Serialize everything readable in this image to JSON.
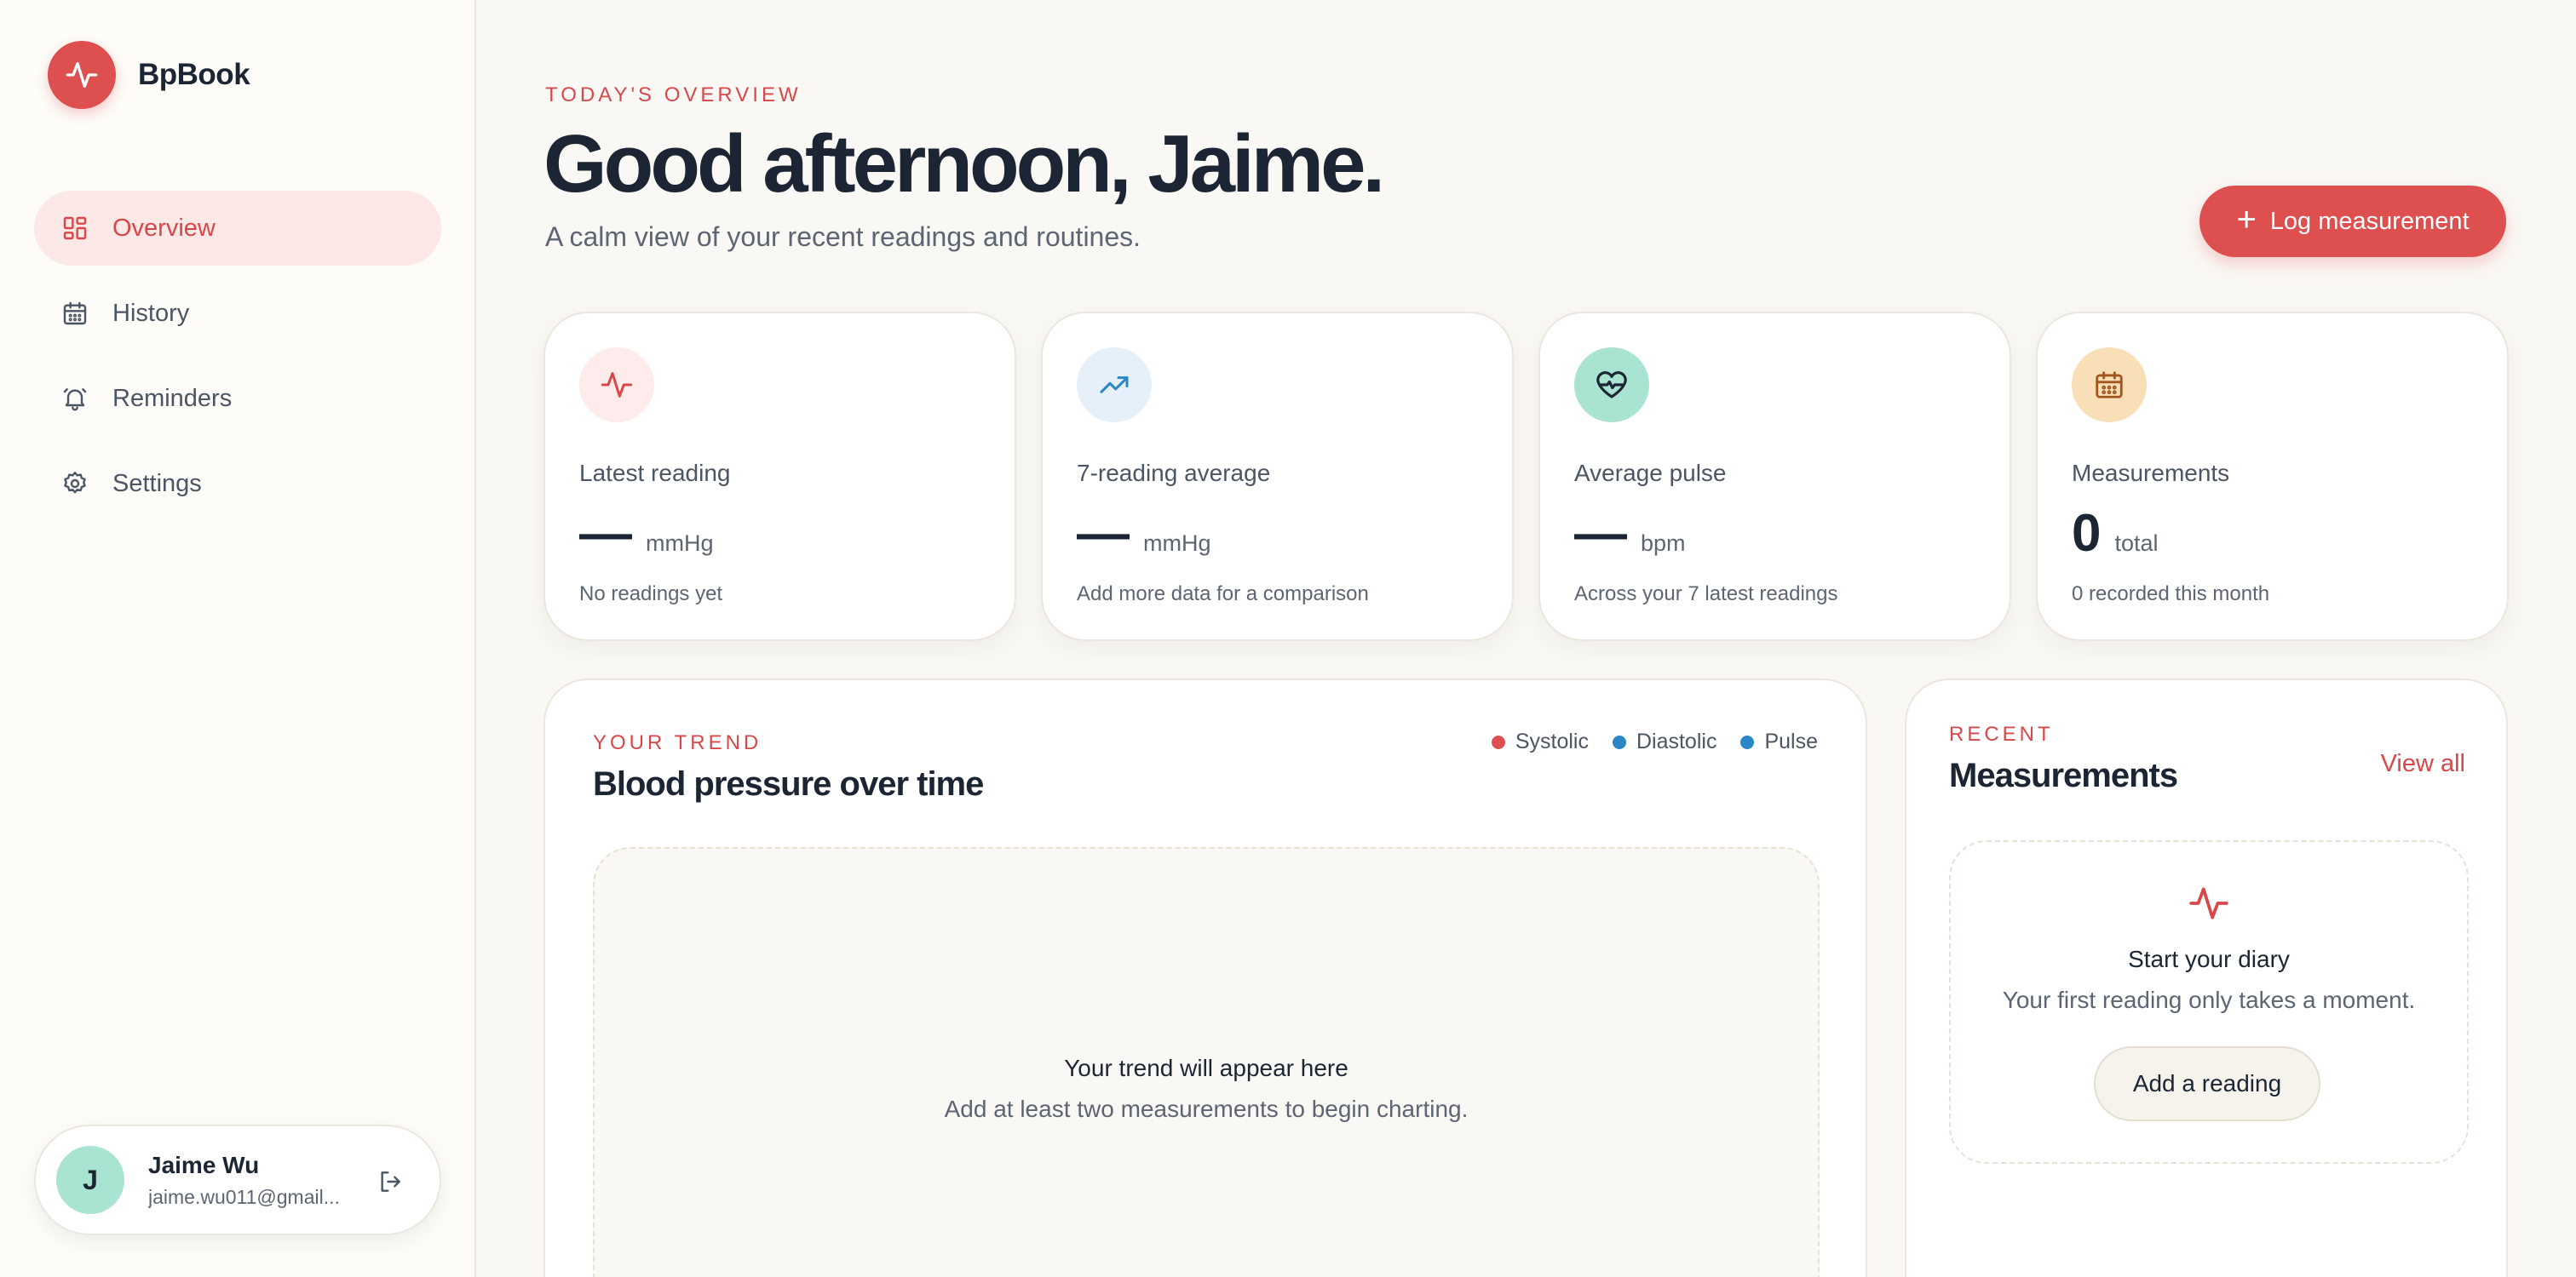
{
  "brand": {
    "name": "BpBook",
    "logo_icon": "pulse-icon",
    "accent": "#de4f4f"
  },
  "sidebar": {
    "items": [
      {
        "label": "Overview",
        "icon": "dashboard-grid-icon",
        "active": true
      },
      {
        "label": "History",
        "icon": "calendar-icon",
        "active": false
      },
      {
        "label": "Reminders",
        "icon": "bell-icon",
        "active": false
      },
      {
        "label": "Settings",
        "icon": "gear-icon",
        "active": false
      }
    ],
    "user": {
      "initial": "J",
      "name": "Jaime Wu",
      "email": "jaime.wu011@gmail...",
      "logout_icon": "logout-icon"
    }
  },
  "header": {
    "eyebrow": "TODAY'S OVERVIEW",
    "title": "Good afternoon, Jaime.",
    "subtitle": "A calm view of your recent readings and routines.",
    "log_button": {
      "icon": "+",
      "label": "Log measurement"
    }
  },
  "stats": [
    {
      "icon": "pulse-icon",
      "icon_bg": "#fdeceb",
      "icon_color": "#d8474a",
      "label": "Latest reading",
      "value": "—",
      "unit": "mmHg",
      "note": "No readings yet"
    },
    {
      "icon": "trending-up-icon",
      "icon_bg": "#e5f0fb",
      "icon_color": "#2b86c5",
      "label": "7-reading average",
      "value": "—",
      "unit": "mmHg",
      "note": "Add more data for a comparison"
    },
    {
      "icon": "heart-pulse-icon",
      "icon_bg": "#a9e4d3",
      "icon_color": "#1c2533",
      "label": "Average pulse",
      "value": "—",
      "unit": "bpm",
      "note": "Across your 7 latest readings"
    },
    {
      "icon": "calendar-icon",
      "icon_bg": "#f9dfb7",
      "icon_color": "#a0561e",
      "label": "Measurements",
      "value": "0",
      "unit": "total",
      "note": "0 recorded this month"
    }
  ],
  "trend": {
    "eyebrow": "YOUR TREND",
    "title": "Blood pressure over time",
    "legend": [
      {
        "name": "Systolic",
        "color": "#de4f4f"
      },
      {
        "name": "Diastolic",
        "color": "#2b86c5"
      },
      {
        "name": "Pulse",
        "color": "#2b86c5"
      }
    ],
    "empty_title": "Your trend will appear here",
    "empty_subtitle": "Add at least two measurements to begin charting."
  },
  "recent": {
    "eyebrow": "RECENT",
    "title": "Measurements",
    "view_all": "View all",
    "empty_icon": "pulse-icon",
    "empty_title": "Start your diary",
    "empty_subtitle": "Your first reading only takes a moment.",
    "add_button": "Add a reading"
  }
}
